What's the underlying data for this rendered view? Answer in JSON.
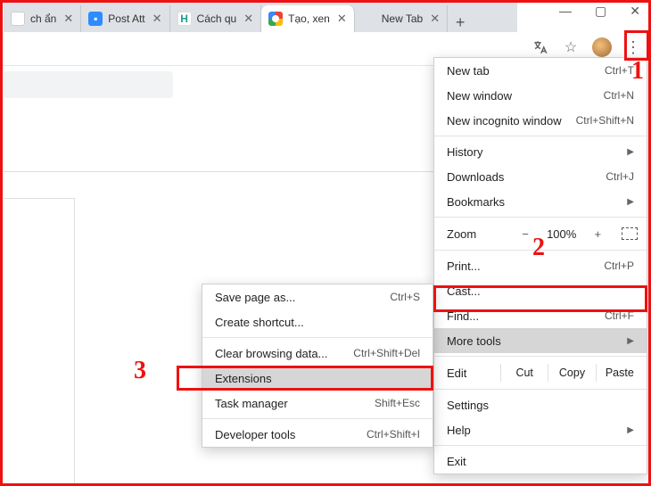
{
  "tabs": [
    {
      "title": "ch ẩn",
      "favicon": "doc"
    },
    {
      "title": "Post Att",
      "favicon": "zoom"
    },
    {
      "title": "Cách qu",
      "favicon": "h"
    },
    {
      "title": "Tạo, xen",
      "favicon": "g",
      "active": true
    },
    {
      "title": "New Tab",
      "favicon": ""
    }
  ],
  "menu": {
    "new_tab": "New tab",
    "new_tab_sc": "Ctrl+T",
    "new_window": "New window",
    "new_window_sc": "Ctrl+N",
    "new_incognito": "New incognito window",
    "new_incognito_sc": "Ctrl+Shift+N",
    "history": "History",
    "downloads": "Downloads",
    "downloads_sc": "Ctrl+J",
    "bookmarks": "Bookmarks",
    "zoom_label": "Zoom",
    "zoom_value": "100%",
    "print": "Print...",
    "print_sc": "Ctrl+P",
    "cast": "Cast...",
    "find": "Find...",
    "find_sc": "Ctrl+F",
    "more_tools": "More tools",
    "edit": "Edit",
    "cut": "Cut",
    "copy": "Copy",
    "paste": "Paste",
    "settings": "Settings",
    "help": "Help",
    "exit": "Exit"
  },
  "submenu": {
    "save_page": "Save page as...",
    "save_page_sc": "Ctrl+S",
    "create_shortcut": "Create shortcut...",
    "clear_data": "Clear browsing data...",
    "clear_data_sc": "Ctrl+Shift+Del",
    "extensions": "Extensions",
    "task_manager": "Task manager",
    "task_manager_sc": "Shift+Esc",
    "dev_tools": "Developer tools",
    "dev_tools_sc": "Ctrl+Shift+I"
  },
  "annotations": {
    "a1": "1",
    "a2": "2",
    "a3": "3"
  }
}
